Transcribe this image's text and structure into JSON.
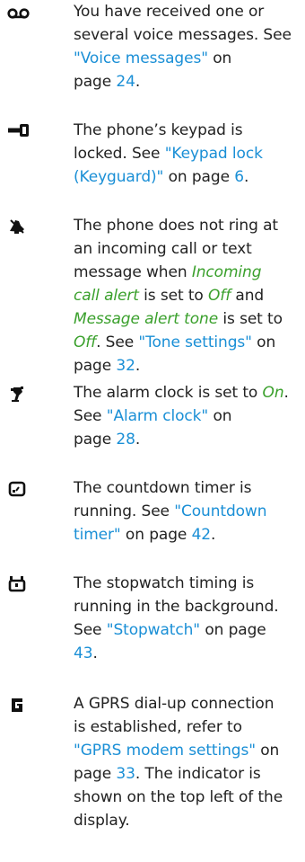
{
  "colors": {
    "text": "#222222",
    "link": "#1a8fd6",
    "emphasis": "#3aa02c",
    "icon": "#111111"
  },
  "entries": [
    {
      "icon": "voice-message-icon",
      "segments": {
        "t1": "You have received one or",
        "t2": "several voice messages. See",
        "l1": "\"Voice messages\"",
        "t3": " on",
        "t4": "page ",
        "l2": "24",
        "t5": "."
      }
    },
    {
      "icon": "keypad-lock-icon",
      "segments": {
        "t1": "The phone’s keypad is",
        "t2": "locked. See ",
        "l1": "\"Keypad lock",
        "l2": "(Keyguard)\"",
        "t3": " on page ",
        "l3": "6",
        "t4": "."
      }
    },
    {
      "icon": "silent-mode-icon",
      "segments": {
        "t1": "The phone does not ring at",
        "t2": "an incoming call or text",
        "t3": "message when ",
        "e1": "Incoming",
        "e2": "call alert",
        "t4": " is set to ",
        "e3": "Off",
        "t5": " and",
        "e4": "Message alert tone",
        "t6": " is set to",
        "e5": "Off",
        "t7": ". See ",
        "l1": "\"Tone settings\"",
        "t8": " on",
        "t9": "page ",
        "l2": "32",
        "t10": "."
      }
    },
    {
      "icon": "alarm-clock-icon",
      "segments": {
        "t1": "The alarm clock is set to ",
        "e1": "On",
        "t2": ".",
        "t3": "See ",
        "l1": "\"Alarm clock\"",
        "t4": " on",
        "t5": "page ",
        "l2": "28",
        "t6": "."
      }
    },
    {
      "icon": "countdown-timer-icon",
      "segments": {
        "t1": "The countdown timer is",
        "t2": "running. See ",
        "l1": "\"Countdown",
        "l2": "timer\"",
        "t3": " on page ",
        "l3": "42",
        "t4": "."
      }
    },
    {
      "icon": "stopwatch-icon",
      "segments": {
        "t1": "The stopwatch timing is",
        "t2": "running in the background.",
        "t3": "See ",
        "l1": "\"Stopwatch\"",
        "t4": " on page",
        "l2": "43",
        "t5": "."
      }
    },
    {
      "icon": "gprs-icon",
      "segments": {
        "t1": "A GPRS dial-up connection",
        "t2": "is established, refer to",
        "l1": "\"GPRS modem settings\"",
        "t3": " on",
        "t4": "page ",
        "l2": "33",
        "t5": ". The indicator is",
        "t6": "shown on the top left of the",
        "t7": "display."
      }
    }
  ]
}
